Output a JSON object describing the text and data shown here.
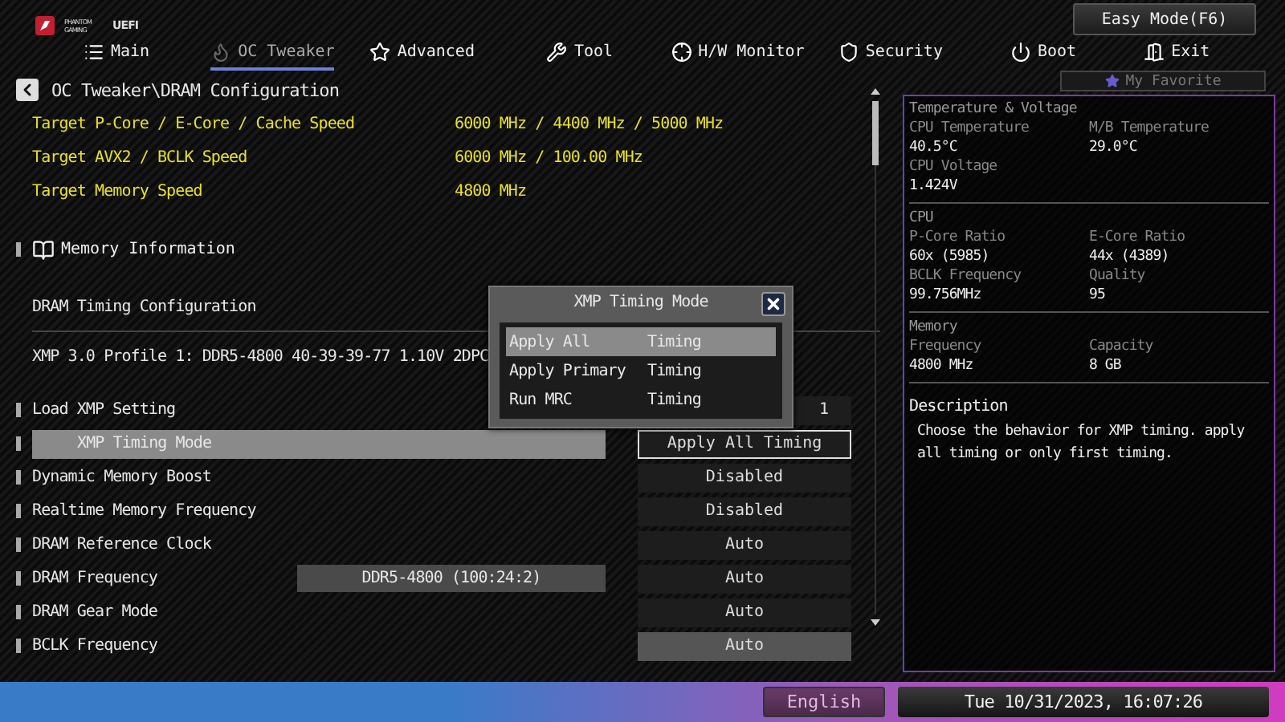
{
  "header": {
    "logo": {
      "brand": "PHANTOM GAMING",
      "label": "UEFI"
    },
    "easy_mode_button": "Easy Mode(F6)",
    "tabs": [
      {
        "label": "Main",
        "selected": false
      },
      {
        "label": "OC Tweaker",
        "selected": true
      },
      {
        "label": "Advanced",
        "selected": false
      },
      {
        "label": "Tool",
        "selected": false
      },
      {
        "label": "H/W Monitor",
        "selected": false
      },
      {
        "label": "Security",
        "selected": false
      },
      {
        "label": "Boot",
        "selected": false
      },
      {
        "label": "Exit",
        "selected": false
      }
    ]
  },
  "breadcrumb": "OC Tweaker\\DRAM Configuration",
  "favorite": "My Favorite",
  "targets": [
    {
      "label": "Target P-Core / E-Core / Cache Speed",
      "value": "6000 MHz / 4400 MHz / 5000 MHz"
    },
    {
      "label": "Target AVX2 / BCLK Speed",
      "value": "6000 MHz / 100.00 MHz"
    },
    {
      "label": "Target Memory Speed",
      "value": "4800 MHz"
    }
  ],
  "memory_information": "Memory Information",
  "timing_heading": "DRAM Timing Configuration",
  "xmp_profile": "XMP 3.0 Profile 1: DDR5-4800 40-39-39-77 1.10V 2DPC",
  "settings": [
    {
      "label": "Load XMP Setting",
      "value": "1",
      "selected": false,
      "hovered": false,
      "covered": true
    },
    {
      "label": "XMP Timing Mode",
      "value": "Apply All Timing",
      "selected": true,
      "hovered": false
    },
    {
      "label": "Dynamic Memory Boost",
      "value": "Disabled",
      "selected": false,
      "hovered": false
    },
    {
      "label": "Realtime Memory Frequency",
      "value": "Disabled",
      "selected": false,
      "hovered": false
    },
    {
      "label": "DRAM Reference Clock",
      "value": "Auto",
      "selected": false,
      "hovered": false
    },
    {
      "label": "DRAM Frequency",
      "info": "DDR5-4800 (100:24:2)",
      "value": "Auto",
      "selected": false,
      "hovered": false
    },
    {
      "label": "DRAM Gear Mode",
      "value": "Auto",
      "selected": false,
      "hovered": false
    },
    {
      "label": "BCLK Frequency",
      "value": "Auto",
      "selected": false,
      "hovered": true
    }
  ],
  "popup": {
    "title": "XMP Timing Mode",
    "options": [
      {
        "parts": [
          "Apply All",
          "Timing"
        ],
        "selected": true
      },
      {
        "parts": [
          "Apply Primary",
          "Timing"
        ],
        "selected": false
      },
      {
        "parts": [
          "Run MRC",
          "Timing"
        ],
        "selected": false
      }
    ]
  },
  "monitor": [
    {
      "title": "Temperature & Voltage",
      "items": [
        {
          "label": "CPU Temperature",
          "value": "40.5°C"
        },
        {
          "label": "M/B Temperature",
          "value": "29.0°C"
        },
        {
          "label": "CPU Voltage",
          "value": "1.424V"
        }
      ]
    },
    {
      "title": "CPU",
      "items": [
        {
          "label": "P-Core Ratio",
          "value": "60x (5985)"
        },
        {
          "label": "E-Core Ratio",
          "value": "44x (4389)"
        },
        {
          "label": "BCLK Frequency",
          "value": "99.756MHz"
        },
        {
          "label": "Quality",
          "value": "95"
        }
      ]
    },
    {
      "title": "Memory",
      "items": [
        {
          "label": "Frequency",
          "value": "4800 MHz"
        },
        {
          "label": "Capacity",
          "value": "8 GB"
        }
      ]
    }
  ],
  "description": {
    "title": "Description",
    "text": "Choose the behavior for XMP timing. apply all timing or only first timing."
  },
  "footer": {
    "language": "English",
    "datetime": "Tue 10/31/2023, 16:07:26"
  }
}
